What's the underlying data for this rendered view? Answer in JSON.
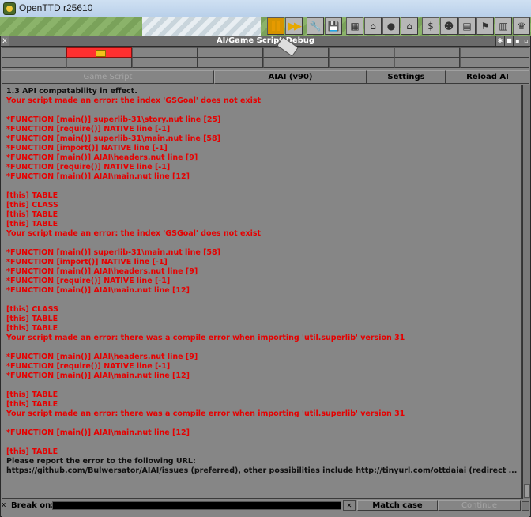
{
  "os_window": {
    "title": "OpenTTD r25610"
  },
  "toolbar": {
    "icons": [
      "pause-icon",
      "fast-forward-icon",
      "settings-icon",
      "save-icon",
      "map-icon",
      "town-directory-icon",
      "subsidies-icon",
      "stations-icon",
      "finances-icon",
      "company-icon",
      "story-book-icon",
      "goals-icon",
      "graphs-icon",
      "league-icon"
    ]
  },
  "debug_window": {
    "title": "AI/Game Script Debug",
    "tabs": {
      "game_script": "Game Script",
      "ai_name": "AIAI (v90)",
      "settings": "Settings",
      "reload": "Reload AI"
    },
    "log_lines": [
      {
        "text": "1.3 API compatability in effect.",
        "color": "black"
      },
      {
        "text": "Your script made an error: the index 'GSGoal' does not exist",
        "color": "red"
      },
      {
        "text": "",
        "color": "red"
      },
      {
        "text": "*FUNCTION [main()] superlib-31\\story.nut line [25]",
        "color": "red"
      },
      {
        "text": "*FUNCTION [require()] NATIVE line [-1]",
        "color": "red"
      },
      {
        "text": "*FUNCTION [main()] superlib-31\\main.nut line [58]",
        "color": "red"
      },
      {
        "text": "*FUNCTION [import()] NATIVE line [-1]",
        "color": "red"
      },
      {
        "text": "*FUNCTION [main()] AIAI\\headers.nut line [9]",
        "color": "red"
      },
      {
        "text": "*FUNCTION [require()] NATIVE line [-1]",
        "color": "red"
      },
      {
        "text": "*FUNCTION [main()] AIAI\\main.nut line [12]",
        "color": "red"
      },
      {
        "text": "",
        "color": "red"
      },
      {
        "text": "[this] TABLE",
        "color": "red"
      },
      {
        "text": "[this] CLASS",
        "color": "red"
      },
      {
        "text": "[this] TABLE",
        "color": "red"
      },
      {
        "text": "[this] TABLE",
        "color": "red"
      },
      {
        "text": "Your script made an error: the index 'GSGoal' does not exist",
        "color": "red"
      },
      {
        "text": "",
        "color": "red"
      },
      {
        "text": "*FUNCTION [main()] superlib-31\\main.nut line [58]",
        "color": "red"
      },
      {
        "text": "*FUNCTION [import()] NATIVE line [-1]",
        "color": "red"
      },
      {
        "text": "*FUNCTION [main()] AIAI\\headers.nut line [9]",
        "color": "red"
      },
      {
        "text": "*FUNCTION [require()] NATIVE line [-1]",
        "color": "red"
      },
      {
        "text": "*FUNCTION [main()] AIAI\\main.nut line [12]",
        "color": "red"
      },
      {
        "text": "",
        "color": "red"
      },
      {
        "text": "[this] CLASS",
        "color": "red"
      },
      {
        "text": "[this] TABLE",
        "color": "red"
      },
      {
        "text": "[this] TABLE",
        "color": "red"
      },
      {
        "text": "Your script made an error: there was a compile error when importing 'util.superlib' version 31",
        "color": "red"
      },
      {
        "text": "",
        "color": "red"
      },
      {
        "text": "*FUNCTION [main()] AIAI\\headers.nut line [9]",
        "color": "red"
      },
      {
        "text": "*FUNCTION [require()] NATIVE line [-1]",
        "color": "red"
      },
      {
        "text": "*FUNCTION [main()] AIAI\\main.nut line [12]",
        "color": "red"
      },
      {
        "text": "",
        "color": "red"
      },
      {
        "text": "[this] TABLE",
        "color": "red"
      },
      {
        "text": "[this] TABLE",
        "color": "red"
      },
      {
        "text": "Your script made an error: there was a compile error when importing 'util.superlib' version 31",
        "color": "red"
      },
      {
        "text": "",
        "color": "red"
      },
      {
        "text": "*FUNCTION [main()] AIAI\\main.nut line [12]",
        "color": "red"
      },
      {
        "text": "",
        "color": "red"
      },
      {
        "text": "[this] TABLE",
        "color": "red"
      },
      {
        "text": "Please report the error to the following URL:",
        "color": "black"
      },
      {
        "text": "https://github.com/Bulwersator/AIAI/issues (preferred), other possibilities include http://tinyurl.com/ottdaiai (redirect ...",
        "color": "black"
      }
    ],
    "bottom": {
      "break_on_label": "Break on:",
      "break_on_value": "",
      "clear_icon": "✕",
      "match_case": "Match case",
      "continue": "Continue"
    }
  },
  "colors": {
    "window_bg": "#858585",
    "error_text": "#e60000",
    "active_ai_slot": "#ff3030"
  }
}
